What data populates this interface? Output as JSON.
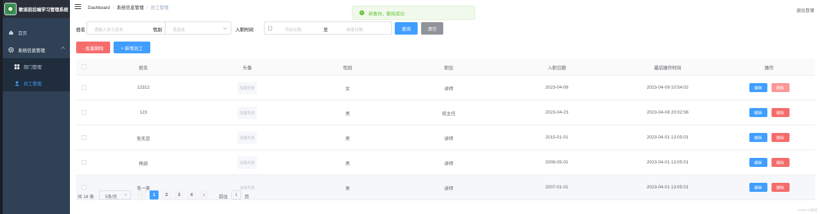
{
  "app": {
    "title": "歌谣前后端学习管理系统"
  },
  "sidebar": {
    "items": [
      {
        "label": "首页",
        "icon": "home-icon"
      },
      {
        "label": "系统信息管理",
        "icon": "gear-icon",
        "children": [
          {
            "label": "部门管理",
            "icon": "grid-icon"
          },
          {
            "label": "员工管理",
            "icon": "user-icon",
            "active": true
          }
        ]
      }
    ]
  },
  "header": {
    "breadcrumb": [
      "Dashboard",
      "系统信息管理",
      "员工管理"
    ],
    "logout": "退出登录"
  },
  "toast": {
    "message": "恭喜你，删除成功"
  },
  "search": {
    "name_label": "姓名",
    "name_placeholder": "请输入员工姓名",
    "gender_label": "性别",
    "gender_placeholder": "请选择",
    "date_label": "入职时间",
    "start_placeholder": "开始日期",
    "to": "至",
    "end_placeholder": "结束日期",
    "query": "查询",
    "clear": "清空"
  },
  "actions": {
    "batch_delete": "- 批量删除",
    "add": "+ 新增员工"
  },
  "table": {
    "columns": [
      "姓名",
      "头像",
      "性别",
      "职位",
      "入职日期",
      "最后操作时间",
      "操作"
    ],
    "avatar_text": "加载失败",
    "edit_label": "编辑",
    "delete_label": "删除",
    "rows": [
      {
        "name": "12312",
        "gender": "女",
        "position": "讲师",
        "entry": "2023-04-09",
        "updated": "2023-04-09 10:54:02"
      },
      {
        "name": "123",
        "gender": "男",
        "position": "班主任",
        "entry": "2023-04-23",
        "updated": "2023-04-08 20:02:56"
      },
      {
        "name": "张无忌",
        "gender": "男",
        "position": "讲师",
        "entry": "2015-01-01",
        "updated": "2023-04-01 13:05:01"
      },
      {
        "name": "杨逍",
        "gender": "男",
        "position": "讲师",
        "entry": "2008-05-01",
        "updated": "2023-04-01 13:05:01"
      },
      {
        "name": "韦一笑",
        "gender": "男",
        "position": "讲师",
        "entry": "2007-01-01",
        "updated": "2023-04-01 13:05:01"
      }
    ]
  },
  "pagination": {
    "total": "共 18 条",
    "page_size": "5条/页",
    "pages": [
      "1",
      "2",
      "3",
      "4"
    ],
    "prev": "‹",
    "next": "›",
    "goto_label": "前往",
    "goto_value": "1",
    "page_suffix": "页"
  },
  "watermark": "CSDN @歌谣"
}
